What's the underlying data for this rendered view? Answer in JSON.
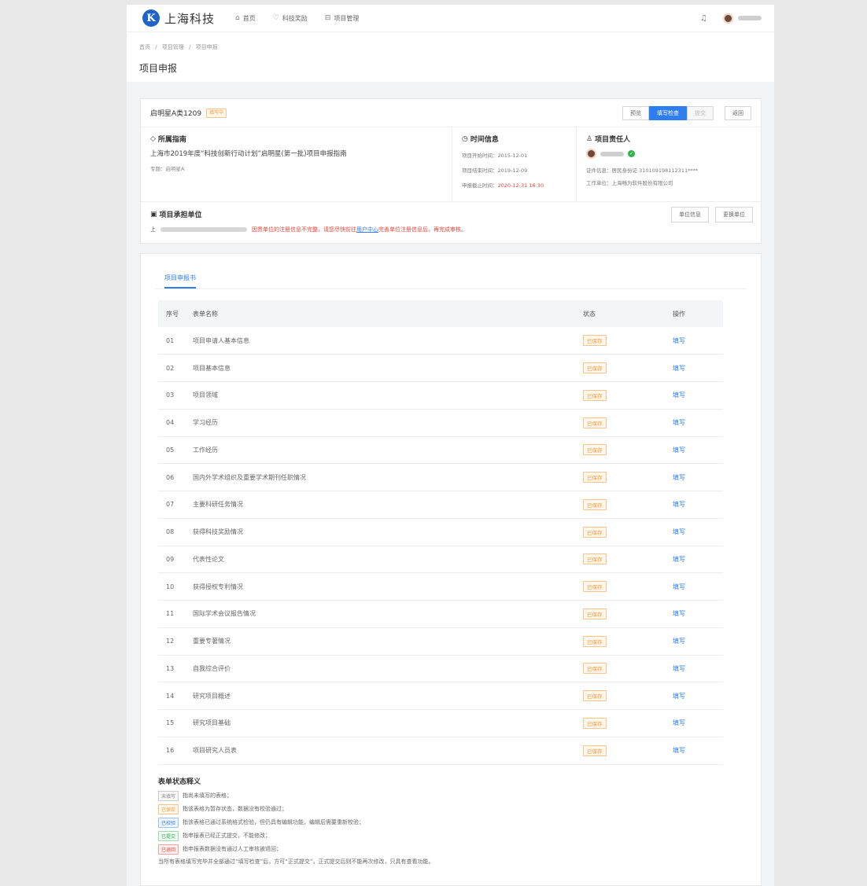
{
  "app": {
    "logo_letter": "K",
    "name": "上海科技"
  },
  "nav": {
    "items": [
      {
        "label": "首页",
        "icon": "home-icon"
      },
      {
        "label": "科技奖励",
        "icon": "trophy-icon"
      },
      {
        "label": "项目管理",
        "icon": "project-icon"
      }
    ],
    "bell_icon": "bell-icon"
  },
  "breadcrumb": [
    "首页",
    "/",
    "项目管理",
    "/",
    "项目申报"
  ],
  "page_title": "项目申报",
  "project": {
    "name": "启明星A类1209",
    "status_tag": "填写中",
    "buttons": {
      "preview": "预览",
      "check": "填写检查",
      "submit": "提交",
      "back": "返回"
    },
    "guide": {
      "title": "所属指南",
      "text": "上海市2019年度“科技创新行动计划”启明星(第一批)项目申报指南",
      "special": "专题：启明星A"
    },
    "time": {
      "title": "时间信息",
      "start_label": "项目开始时间：",
      "start": "2015-12-01",
      "end_label": "项目结束时间：",
      "end": "2019-12-09",
      "deadline_label": "申报截止时间：",
      "deadline": "2020-12-31 16:30"
    },
    "leader": {
      "title": "项目责任人",
      "id_info": "证件信息：居民身份证 310109198112311****",
      "work_unit": "工作单位：上海畅为软件股份有限公司"
    },
    "unit": {
      "title": "项目承担单位",
      "prefix": "上",
      "warn_before": "因贵单位的注册信息不完整，请您尽快前往",
      "warn_link": "用户中心",
      "warn_after": "完善单位注册信息后，再完成审核。",
      "btn_info": "单位信息",
      "btn_change": "更换单位"
    }
  },
  "tab_label": "项目申报书",
  "table": {
    "headers": {
      "no": "序号",
      "name": "表单名称",
      "status": "状态",
      "op": "操作"
    },
    "rows": [
      {
        "no": "01",
        "name": "项目申请人基本信息",
        "status": "已保存",
        "op": "填写"
      },
      {
        "no": "02",
        "name": "项目基本信息",
        "status": "已保存",
        "op": "填写"
      },
      {
        "no": "03",
        "name": "项目领域",
        "status": "已保存",
        "op": "填写"
      },
      {
        "no": "04",
        "name": "学习经历",
        "status": "已保存",
        "op": "填写"
      },
      {
        "no": "05",
        "name": "工作经历",
        "status": "已保存",
        "op": "填写"
      },
      {
        "no": "06",
        "name": "国内外学术组织及重要学术期刊任职情况",
        "status": "已保存",
        "op": "填写"
      },
      {
        "no": "07",
        "name": "主要科研任务情况",
        "status": "已保存",
        "op": "填写"
      },
      {
        "no": "08",
        "name": "获得科技奖励情况",
        "status": "已保存",
        "op": "填写"
      },
      {
        "no": "09",
        "name": "代表性论文",
        "status": "已保存",
        "op": "填写"
      },
      {
        "no": "10",
        "name": "获得授权专利情况",
        "status": "已保存",
        "op": "填写"
      },
      {
        "no": "11",
        "name": "国际学术会议报告情况",
        "status": "已保存",
        "op": "填写"
      },
      {
        "no": "12",
        "name": "重要专著情况",
        "status": "已保存",
        "op": "填写"
      },
      {
        "no": "13",
        "name": "自我综合评价",
        "status": "已保存",
        "op": "填写"
      },
      {
        "no": "14",
        "name": "研究项目概述",
        "status": "已保存",
        "op": "填写"
      },
      {
        "no": "15",
        "name": "研究项目基础",
        "status": "已保存",
        "op": "填写"
      },
      {
        "no": "16",
        "name": "项目研究人员表",
        "status": "已保存",
        "op": "填写"
      }
    ]
  },
  "legend": {
    "title": "表单状态释义",
    "items": [
      {
        "tag": "未填写",
        "text": "指尚未填写的表格；",
        "color": "gray"
      },
      {
        "tag": "已保存",
        "text": "指该表格为暂存状态，数据没有校验通过；",
        "color": "orange"
      },
      {
        "tag": "已校验",
        "text": "指该表格已通过系统格式检验，但仍具有编辑功能，编辑后需要重新校验；",
        "color": "blue"
      },
      {
        "tag": "已提交",
        "text": "指申报表已经正式提交，不能修改；",
        "color": "green"
      },
      {
        "tag": "已退回",
        "text": "指申报表数据没有通过人工审核被退回；",
        "color": "red"
      }
    ],
    "note": "当所有表格填写完毕并全部通过“填写检查”后，方可“正式提交”，正式提交后则不能再次修改，只具有查看功能。"
  }
}
